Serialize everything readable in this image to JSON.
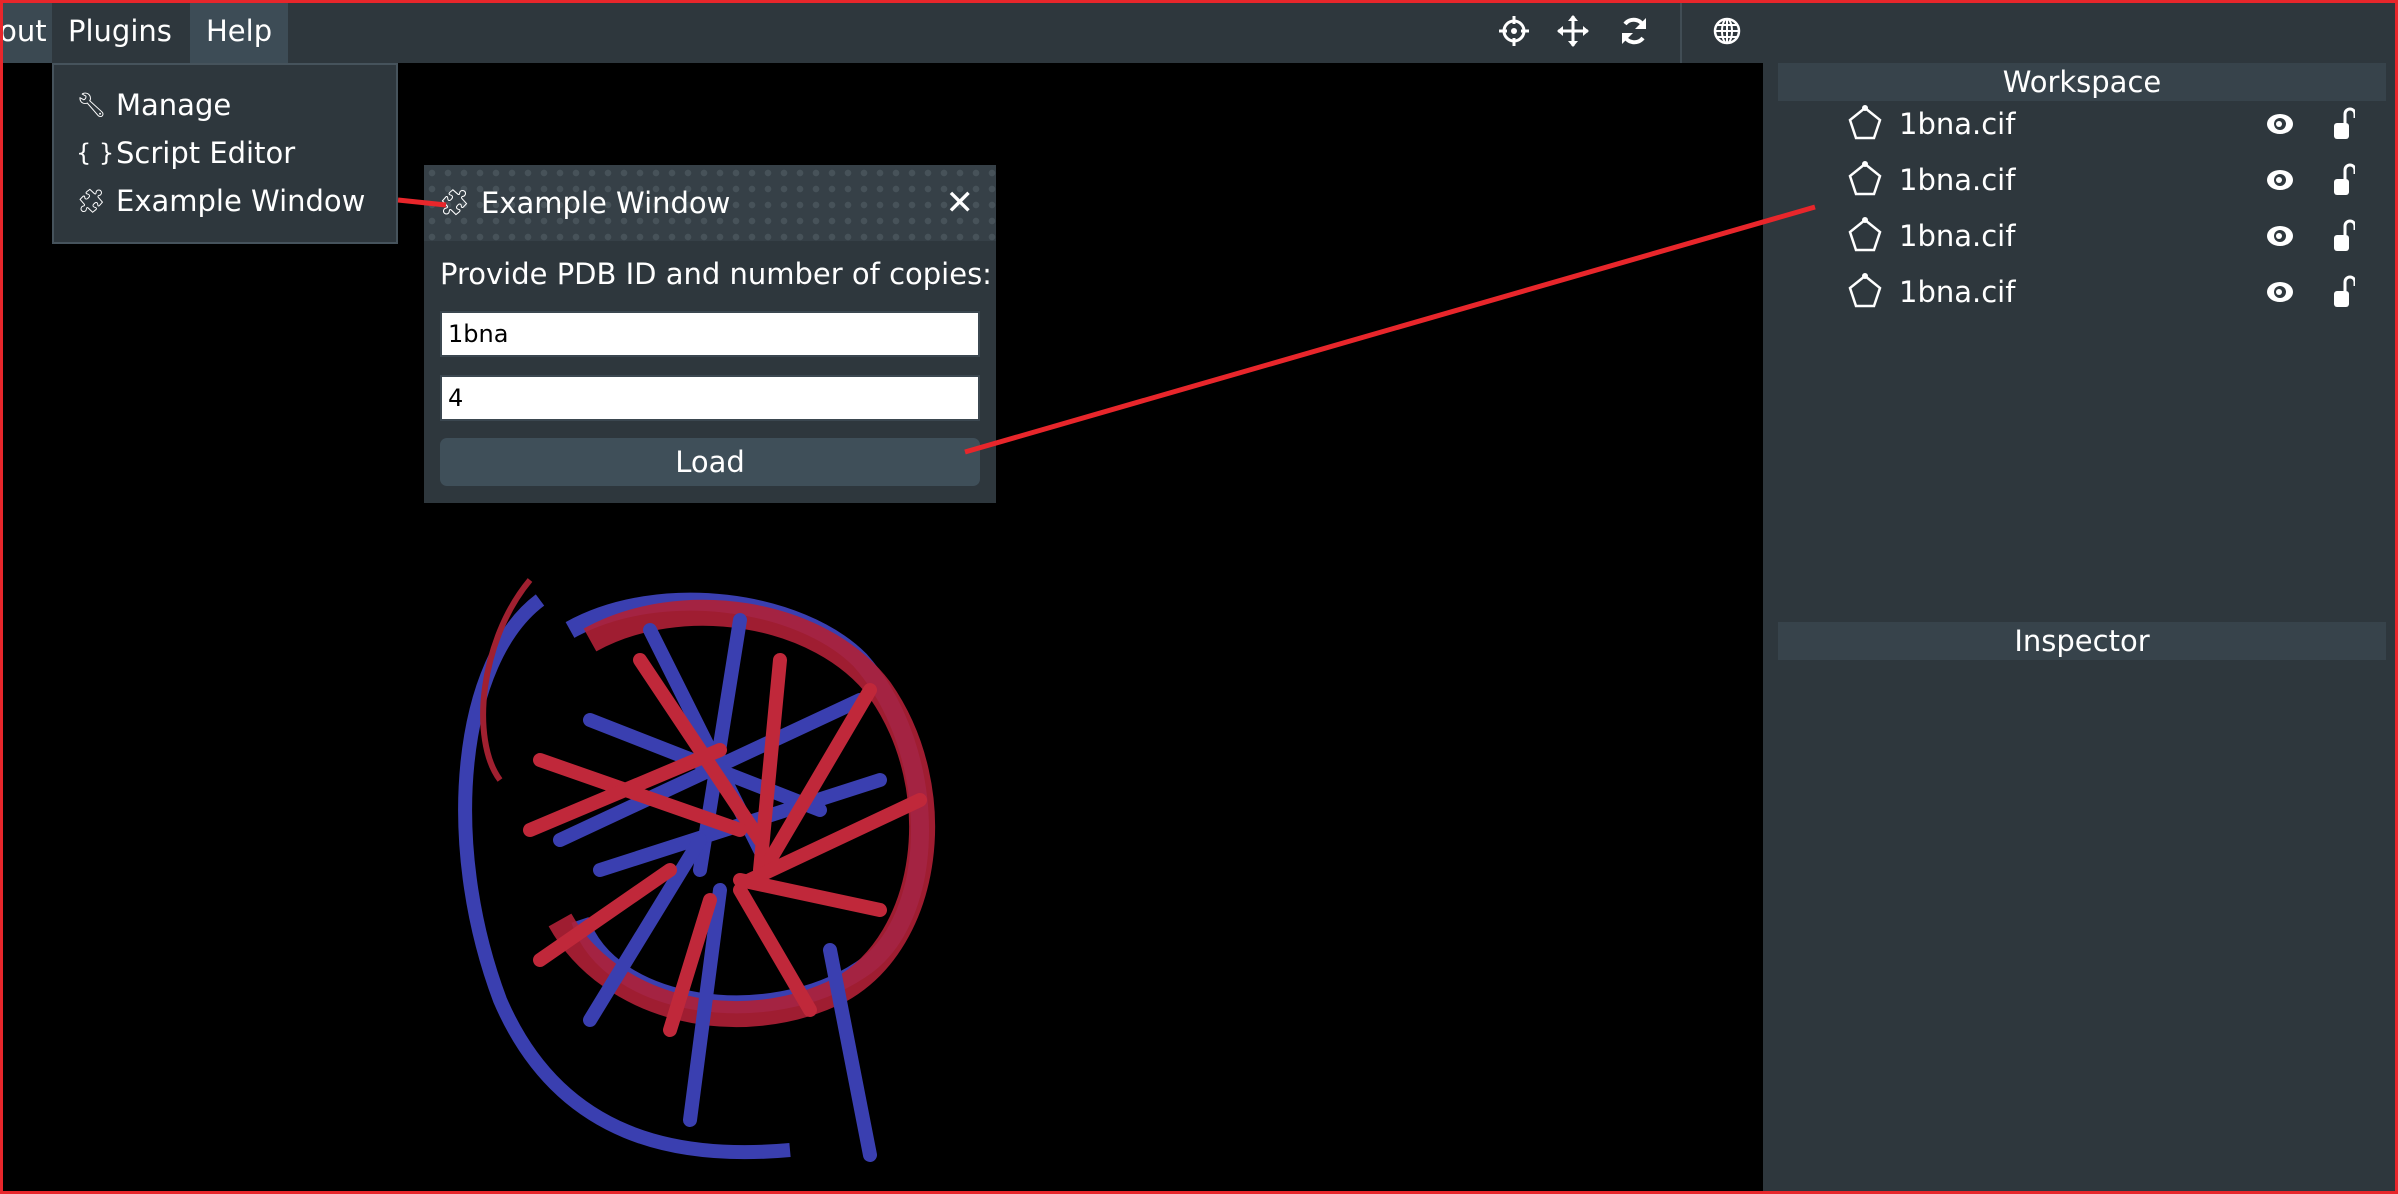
{
  "menubar": {
    "items": [
      {
        "label": "Layout"
      },
      {
        "label": "Plugins"
      },
      {
        "label": "Help"
      }
    ],
    "layout_visible": "out"
  },
  "toolbar": {
    "icons": [
      "crosshair-icon",
      "move-icon",
      "refresh-icon",
      "globe-icon"
    ]
  },
  "plugins_menu": {
    "items": [
      {
        "label": "Manage",
        "icon": "wrench-icon"
      },
      {
        "label": "Script Editor",
        "icon": "braces-icon"
      },
      {
        "label": "Example Window",
        "icon": "puzzle-icon"
      }
    ]
  },
  "example_window": {
    "title": "Example Window",
    "prompt": "Provide PDB ID and number of copies:",
    "pdb_id": "1bna",
    "copies": "4",
    "load_label": "Load"
  },
  "workspace": {
    "title": "Workspace",
    "items": [
      {
        "name": "1bna.cif"
      },
      {
        "name": "1bna.cif"
      },
      {
        "name": "1bna.cif"
      },
      {
        "name": "1bna.cif"
      }
    ]
  },
  "inspector": {
    "title": "Inspector"
  },
  "colors": {
    "annotation": "#e8262b",
    "panel": "#2e373d",
    "strand_red": "#c0283a",
    "strand_blue": "#3a3fb0"
  }
}
